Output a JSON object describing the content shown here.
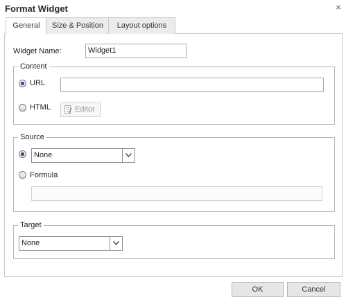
{
  "dialog": {
    "title": "Format Widget",
    "close_glyph": "×"
  },
  "tabs": [
    {
      "label": "General",
      "active": true
    },
    {
      "label": "Size & Position",
      "active": false
    },
    {
      "label": "Layout options",
      "active": false
    }
  ],
  "general": {
    "widget_name_label": "Widget Name:",
    "widget_name_value": "Widget1",
    "content": {
      "legend": "Content",
      "url_label": "URL",
      "url_value": "",
      "url_selected": true,
      "html_label": "HTML",
      "html_selected": false,
      "editor_label": "Editor",
      "editor_icon": "document-edit-icon"
    },
    "source": {
      "legend": "Source",
      "none_selected": true,
      "dropdown_value": "None",
      "formula_label": "Formula",
      "formula_selected": false,
      "formula_value": ""
    },
    "target": {
      "legend": "Target",
      "dropdown_value": "None"
    }
  },
  "footer": {
    "ok_label": "OK",
    "cancel_label": "Cancel"
  },
  "colors": {
    "radio_dot": "#1f4b8f",
    "border": "#c9c9c9",
    "button_bg": "#e6e6e6"
  }
}
